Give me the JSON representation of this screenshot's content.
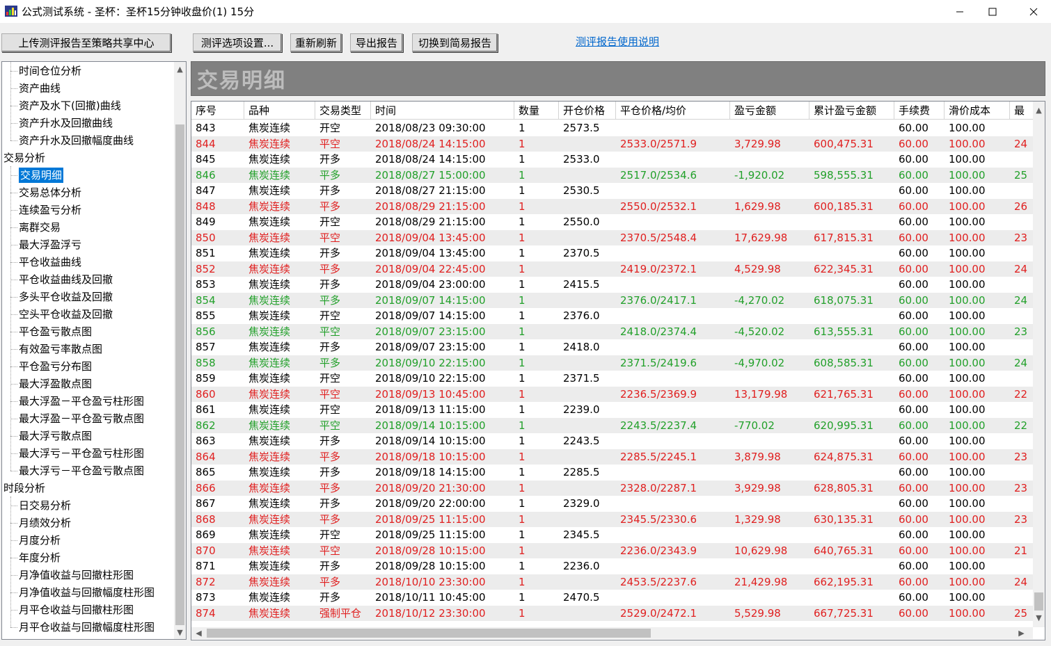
{
  "window": {
    "title": "公式测试系统 - 圣杯：圣杯15分钟收盘价(1) 15分",
    "minimize": "—",
    "maximize": "☐",
    "close": "✕"
  },
  "toolbar": {
    "upload": "上传测评报告至策略共享中心",
    "options": "测评选项设置...",
    "refresh": "重新刷新",
    "export": "导出报告",
    "switch": "切换到简易报告",
    "help_link": "测评报告使用说明"
  },
  "tree": {
    "items": [
      {
        "label": "时间仓位分析",
        "level": 1
      },
      {
        "label": "资产曲线",
        "level": 1
      },
      {
        "label": "资产及水下(回撤)曲线",
        "level": 1
      },
      {
        "label": "资产升水及回撤曲线",
        "level": 1
      },
      {
        "label": "资产升水及回撤幅度曲线",
        "level": 1
      },
      {
        "label": "交易分析",
        "level": 0
      },
      {
        "label": "交易明细",
        "level": 1,
        "selected": true
      },
      {
        "label": "交易总体分析",
        "level": 1
      },
      {
        "label": "连续盈亏分析",
        "level": 1
      },
      {
        "label": "离群交易",
        "level": 1
      },
      {
        "label": "最大浮盈浮亏",
        "level": 1
      },
      {
        "label": "平仓收益曲线",
        "level": 1
      },
      {
        "label": "平仓收益曲线及回撤",
        "level": 1
      },
      {
        "label": "多头平仓收益及回撤",
        "level": 1
      },
      {
        "label": "空头平仓收益及回撤",
        "level": 1
      },
      {
        "label": "平仓盈亏散点图",
        "level": 1
      },
      {
        "label": "有效盈亏率散点图",
        "level": 1
      },
      {
        "label": "平仓盈亏分布图",
        "level": 1
      },
      {
        "label": "最大浮盈散点图",
        "level": 1
      },
      {
        "label": "最大浮盈－平仓盈亏柱形图",
        "level": 1
      },
      {
        "label": "最大浮盈－平仓盈亏散点图",
        "level": 1
      },
      {
        "label": "最大浮亏散点图",
        "level": 1
      },
      {
        "label": "最大浮亏－平仓盈亏柱形图",
        "level": 1
      },
      {
        "label": "最大浮亏－平仓盈亏散点图",
        "level": 1
      },
      {
        "label": "时段分析",
        "level": 0
      },
      {
        "label": "日交易分析",
        "level": 1
      },
      {
        "label": "月绩效分析",
        "level": 1
      },
      {
        "label": "月度分析",
        "level": 1
      },
      {
        "label": "年度分析",
        "level": 1
      },
      {
        "label": "月净值收益与回撤柱形图",
        "level": 1
      },
      {
        "label": "月净值收益与回撤幅度柱形图",
        "level": 1
      },
      {
        "label": "月平仓收益与回撤柱形图",
        "level": 1
      },
      {
        "label": "月平仓收益与回撤幅度柱形图",
        "level": 1
      }
    ]
  },
  "banner": {
    "title": "交易明细"
  },
  "table": {
    "columns": [
      "序号",
      "品种",
      "交易类型",
      "时间",
      "数量",
      "开仓价格",
      "平仓价格/均价",
      "盈亏金额",
      "累计盈亏金额",
      "手续费",
      "滑价成本",
      "最"
    ],
    "rows": [
      {
        "c": [
          "843",
          "焦炭连续",
          "开空",
          "2018/08/23 09:30:00",
          "1",
          "2573.5",
          "",
          "",
          "",
          "60.00",
          "100.00",
          ""
        ],
        "color": "black"
      },
      {
        "c": [
          "844",
          "焦炭连续",
          "平空",
          "2018/08/24 14:15:00",
          "1",
          "",
          "2533.0/2571.9",
          "3,729.98",
          "600,475.31",
          "60.00",
          "100.00",
          "24"
        ],
        "color": "red"
      },
      {
        "c": [
          "845",
          "焦炭连续",
          "开多",
          "2018/08/24 14:15:00",
          "1",
          "2533.0",
          "",
          "",
          "",
          "60.00",
          "100.00",
          ""
        ],
        "color": "black"
      },
      {
        "c": [
          "846",
          "焦炭连续",
          "平多",
          "2018/08/27 15:00:00",
          "1",
          "",
          "2517.0/2534.6",
          "-1,920.02",
          "598,555.31",
          "60.00",
          "100.00",
          "25"
        ],
        "color": "green"
      },
      {
        "c": [
          "847",
          "焦炭连续",
          "开多",
          "2018/08/27 21:15:00",
          "1",
          "2530.5",
          "",
          "",
          "",
          "60.00",
          "100.00",
          ""
        ],
        "color": "black"
      },
      {
        "c": [
          "848",
          "焦炭连续",
          "平多",
          "2018/08/29 21:15:00",
          "1",
          "",
          "2550.0/2532.1",
          "1,629.98",
          "600,185.31",
          "60.00",
          "100.00",
          "26"
        ],
        "color": "red"
      },
      {
        "c": [
          "849",
          "焦炭连续",
          "开空",
          "2018/08/29 21:15:00",
          "1",
          "2550.0",
          "",
          "",
          "",
          "60.00",
          "100.00",
          ""
        ],
        "color": "black"
      },
      {
        "c": [
          "850",
          "焦炭连续",
          "平空",
          "2018/09/04 13:45:00",
          "1",
          "",
          "2370.5/2548.4",
          "17,629.98",
          "617,815.31",
          "60.00",
          "100.00",
          "23"
        ],
        "color": "red"
      },
      {
        "c": [
          "851",
          "焦炭连续",
          "开多",
          "2018/09/04 13:45:00",
          "1",
          "2370.5",
          "",
          "",
          "",
          "60.00",
          "100.00",
          ""
        ],
        "color": "black"
      },
      {
        "c": [
          "852",
          "焦炭连续",
          "平多",
          "2018/09/04 22:45:00",
          "1",
          "",
          "2419.0/2372.1",
          "4,529.98",
          "622,345.31",
          "60.00",
          "100.00",
          "24"
        ],
        "color": "red"
      },
      {
        "c": [
          "853",
          "焦炭连续",
          "开多",
          "2018/09/04 23:00:00",
          "1",
          "2415.5",
          "",
          "",
          "",
          "60.00",
          "100.00",
          ""
        ],
        "color": "black"
      },
      {
        "c": [
          "854",
          "焦炭连续",
          "平多",
          "2018/09/07 14:15:00",
          "1",
          "",
          "2376.0/2417.1",
          "-4,270.02",
          "618,075.31",
          "60.00",
          "100.00",
          "24"
        ],
        "color": "green"
      },
      {
        "c": [
          "855",
          "焦炭连续",
          "开空",
          "2018/09/07 14:15:00",
          "1",
          "2376.0",
          "",
          "",
          "",
          "60.00",
          "100.00",
          ""
        ],
        "color": "black"
      },
      {
        "c": [
          "856",
          "焦炭连续",
          "平空",
          "2018/09/07 23:15:00",
          "1",
          "",
          "2418.0/2374.4",
          "-4,520.02",
          "613,555.31",
          "60.00",
          "100.00",
          "23"
        ],
        "color": "green"
      },
      {
        "c": [
          "857",
          "焦炭连续",
          "开多",
          "2018/09/07 23:15:00",
          "1",
          "2418.0",
          "",
          "",
          "",
          "60.00",
          "100.00",
          ""
        ],
        "color": "black"
      },
      {
        "c": [
          "858",
          "焦炭连续",
          "平多",
          "2018/09/10 22:15:00",
          "1",
          "",
          "2371.5/2419.6",
          "-4,970.02",
          "608,585.31",
          "60.00",
          "100.00",
          "24"
        ],
        "color": "green"
      },
      {
        "c": [
          "859",
          "焦炭连续",
          "开空",
          "2018/09/10 22:15:00",
          "1",
          "2371.5",
          "",
          "",
          "",
          "60.00",
          "100.00",
          ""
        ],
        "color": "black"
      },
      {
        "c": [
          "860",
          "焦炭连续",
          "平空",
          "2018/09/13 10:45:00",
          "1",
          "",
          "2236.5/2369.9",
          "13,179.98",
          "621,765.31",
          "60.00",
          "100.00",
          "22"
        ],
        "color": "red"
      },
      {
        "c": [
          "861",
          "焦炭连续",
          "开空",
          "2018/09/13 11:15:00",
          "1",
          "2239.0",
          "",
          "",
          "",
          "60.00",
          "100.00",
          ""
        ],
        "color": "black"
      },
      {
        "c": [
          "862",
          "焦炭连续",
          "平空",
          "2018/09/14 10:15:00",
          "1",
          "",
          "2243.5/2237.4",
          "-770.02",
          "620,995.31",
          "60.00",
          "100.00",
          "22"
        ],
        "color": "green"
      },
      {
        "c": [
          "863",
          "焦炭连续",
          "开多",
          "2018/09/14 10:15:00",
          "1",
          "2243.5",
          "",
          "",
          "",
          "60.00",
          "100.00",
          ""
        ],
        "color": "black"
      },
      {
        "c": [
          "864",
          "焦炭连续",
          "平多",
          "2018/09/18 10:15:00",
          "1",
          "",
          "2285.5/2245.1",
          "3,879.98",
          "624,875.31",
          "60.00",
          "100.00",
          "23"
        ],
        "color": "red"
      },
      {
        "c": [
          "865",
          "焦炭连续",
          "开多",
          "2018/09/18 14:15:00",
          "1",
          "2285.5",
          "",
          "",
          "",
          "60.00",
          "100.00",
          ""
        ],
        "color": "black"
      },
      {
        "c": [
          "866",
          "焦炭连续",
          "平多",
          "2018/09/20 21:30:00",
          "1",
          "",
          "2328.0/2287.1",
          "3,929.98",
          "628,805.31",
          "60.00",
          "100.00",
          "23"
        ],
        "color": "red"
      },
      {
        "c": [
          "867",
          "焦炭连续",
          "开多",
          "2018/09/20 22:00:00",
          "1",
          "2329.0",
          "",
          "",
          "",
          "60.00",
          "100.00",
          ""
        ],
        "color": "black"
      },
      {
        "c": [
          "868",
          "焦炭连续",
          "平多",
          "2018/09/25 11:15:00",
          "1",
          "",
          "2345.5/2330.6",
          "1,329.98",
          "630,135.31",
          "60.00",
          "100.00",
          "23"
        ],
        "color": "red"
      },
      {
        "c": [
          "869",
          "焦炭连续",
          "开空",
          "2018/09/25 11:15:00",
          "1",
          "2345.5",
          "",
          "",
          "",
          "60.00",
          "100.00",
          ""
        ],
        "color": "black"
      },
      {
        "c": [
          "870",
          "焦炭连续",
          "平空",
          "2018/09/28 10:15:00",
          "1",
          "",
          "2236.0/2343.9",
          "10,629.98",
          "640,765.31",
          "60.00",
          "100.00",
          "21"
        ],
        "color": "red"
      },
      {
        "c": [
          "871",
          "焦炭连续",
          "开多",
          "2018/09/28 10:15:00",
          "1",
          "2236.0",
          "",
          "",
          "",
          "60.00",
          "100.00",
          ""
        ],
        "color": "black"
      },
      {
        "c": [
          "872",
          "焦炭连续",
          "平多",
          "2018/10/10 23:30:00",
          "1",
          "",
          "2453.5/2237.6",
          "21,429.98",
          "662,195.31",
          "60.00",
          "100.00",
          "24"
        ],
        "color": "red"
      },
      {
        "c": [
          "873",
          "焦炭连续",
          "开多",
          "2018/10/11 10:45:00",
          "1",
          "2470.5",
          "",
          "",
          "",
          "60.00",
          "100.00",
          ""
        ],
        "color": "black"
      },
      {
        "c": [
          "874",
          "焦炭连续",
          "强制平仓",
          "2018/10/12 23:30:00",
          "1",
          "",
          "2529.0/2472.1",
          "5,529.98",
          "667,725.31",
          "60.00",
          "100.00",
          "25"
        ],
        "color": "red"
      }
    ]
  },
  "colors": {
    "profit": "#e02020",
    "loss": "#22a02a",
    "selection": "#0078d7",
    "link": "#0066cc"
  }
}
